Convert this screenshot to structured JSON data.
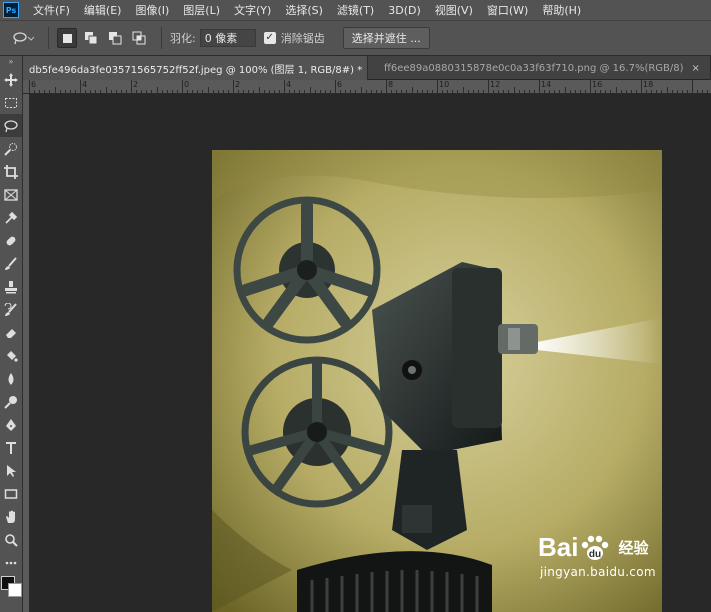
{
  "app": {
    "logo": "Ps"
  },
  "menu": {
    "items": [
      "文件(F)",
      "编辑(E)",
      "图像(I)",
      "图层(L)",
      "文字(Y)",
      "选择(S)",
      "滤镜(T)",
      "3D(D)",
      "视图(V)",
      "窗口(W)",
      "帮助(H)"
    ]
  },
  "options": {
    "feather_label": "羽化:",
    "feather_value": "0 像素",
    "antialias_label": "消除锯齿",
    "antialias_checked": true,
    "select_mask_button": "选择并遮住 ..."
  },
  "tabs": [
    {
      "title": "db5fe496da3fe03571565752ff52f.jpeg @ 100% (图层 1, RGB/8#) *",
      "close": "×",
      "active": true
    },
    {
      "title": "ff6ee89a0880315878e0c0a33f63f710.png @ 16.7%(RGB/8)",
      "close": "×",
      "active": false
    }
  ],
  "ruler": {
    "labels": [
      "6",
      "4",
      "2",
      "0",
      "2",
      "4",
      "6",
      "8",
      "10",
      "12",
      "14",
      "16",
      "18"
    ]
  },
  "tools": [
    {
      "name": "move-tool-icon"
    },
    {
      "name": "marquee-tool-icon"
    },
    {
      "name": "lasso-tool-icon",
      "active": true
    },
    {
      "name": "quick-select-tool-icon"
    },
    {
      "name": "crop-tool-icon"
    },
    {
      "name": "frame-tool-icon"
    },
    {
      "name": "eyedropper-tool-icon"
    },
    {
      "name": "healing-brush-tool-icon"
    },
    {
      "name": "brush-tool-icon"
    },
    {
      "name": "clone-stamp-tool-icon"
    },
    {
      "name": "history-brush-tool-icon"
    },
    {
      "name": "eraser-tool-icon"
    },
    {
      "name": "paint-bucket-tool-icon"
    },
    {
      "name": "blur-tool-icon"
    },
    {
      "name": "dodge-tool-icon"
    },
    {
      "name": "pen-tool-icon"
    },
    {
      "name": "type-tool-icon"
    },
    {
      "name": "path-select-tool-icon"
    },
    {
      "name": "rectangle-tool-icon"
    },
    {
      "name": "hand-tool-icon"
    },
    {
      "name": "zoom-tool-icon"
    },
    {
      "name": "more-tools-icon"
    }
  ],
  "colors": {
    "foreground": "#111111",
    "background": "#ffffff"
  },
  "watermark": {
    "brand_left": "Bai",
    "brand_right": "经验",
    "url": "jingyan.baidu.com"
  }
}
